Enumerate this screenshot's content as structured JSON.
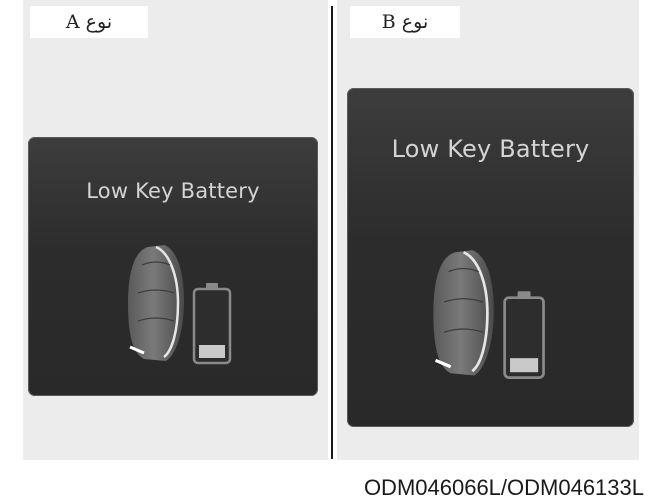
{
  "type_a": {
    "label": "نوع A"
  },
  "type_b": {
    "label": "نوع B"
  },
  "screen_a": {
    "message": "Low Key Battery",
    "icon": "key-fob-low-battery-icon",
    "battery_level": 0.2
  },
  "screen_b": {
    "message": "Low Key Battery",
    "icon": "key-fob-low-battery-icon",
    "battery_level": 0.2
  },
  "figure_code": "ODM046066L/ODM046133L",
  "colors": {
    "screen_background": "#2f2f2f",
    "panel_background": "#ececec",
    "text": "#d4d4d4"
  }
}
